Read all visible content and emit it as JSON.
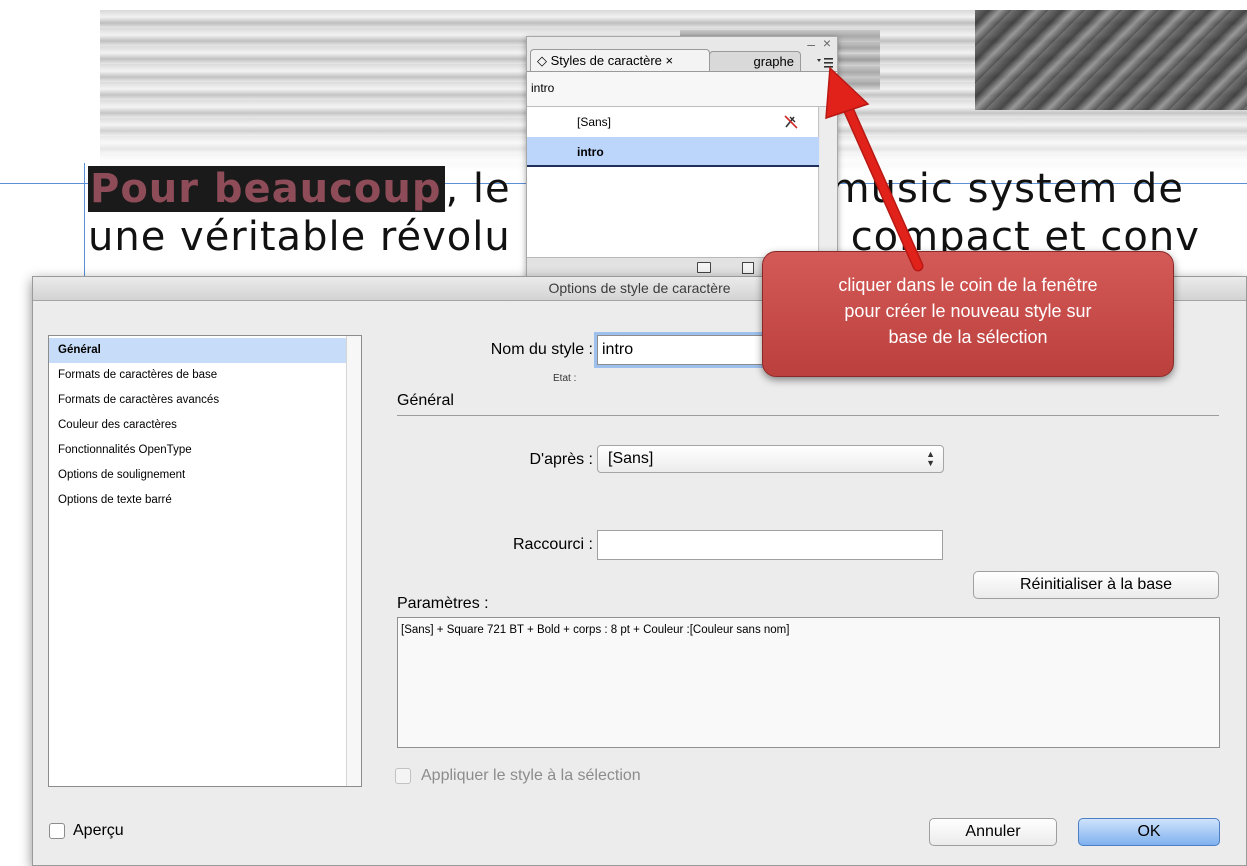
{
  "document": {
    "line1_highlight": "Pour beaucoup",
    "line1_a": ", le",
    "line1_b": "music system de",
    "line2_a": "une véritable révolu",
    "line2_b": "compact et conv"
  },
  "styles_panel": {
    "tab_label": "◇ Styles de caractère ×",
    "tab2_label": "graphe",
    "minimize": "–",
    "close": "×",
    "current_style": "intro",
    "items": [
      {
        "label": "[Sans]"
      },
      {
        "label": "intro"
      }
    ],
    "icons": [
      "menu-icon",
      "no-break-icon",
      "new-group-icon",
      "new-style-icon"
    ]
  },
  "dialog": {
    "title": "Options de style de caractère",
    "sidebar": {
      "items": [
        "Général",
        "Formats de caractères de base",
        "Formats de caractères avancés",
        "Couleur des caractères",
        "Fonctionnalités OpenType",
        "Options de soulignement",
        "Options de texte barré"
      ],
      "selected": "Général"
    },
    "style_name_label": "Nom du style :",
    "style_name_value": "intro",
    "state_label": "Etat :",
    "section_heading": "Général",
    "based_on_label": "D'après :",
    "based_on_value": "[Sans]",
    "shortcut_label": "Raccourci :",
    "shortcut_value": "",
    "reset_button": "Réinitialiser à la base",
    "params_label": "Paramètres :",
    "params_value": "[Sans] + Square 721 BT + Bold + corps : 8 pt + Couleur :[Couleur sans nom]",
    "apply_label": "Appliquer le style à la sélection",
    "apply_checked": false,
    "preview_label": "Aperçu",
    "preview_checked": false,
    "cancel_button": "Annuler",
    "ok_button": "OK"
  },
  "annotation": {
    "lines": [
      "cliquer dans le coin de la fenêtre",
      "pour créer le nouveau style sur",
      "base de la sélection"
    ],
    "color": "#c64a47",
    "arrow_color": "#e0221b"
  },
  "colors": {
    "selection": "#c7dcf8",
    "ok_button": "#7fb1ef",
    "guide": "#5b8fd6",
    "highlight_text": "#8e4c58"
  }
}
